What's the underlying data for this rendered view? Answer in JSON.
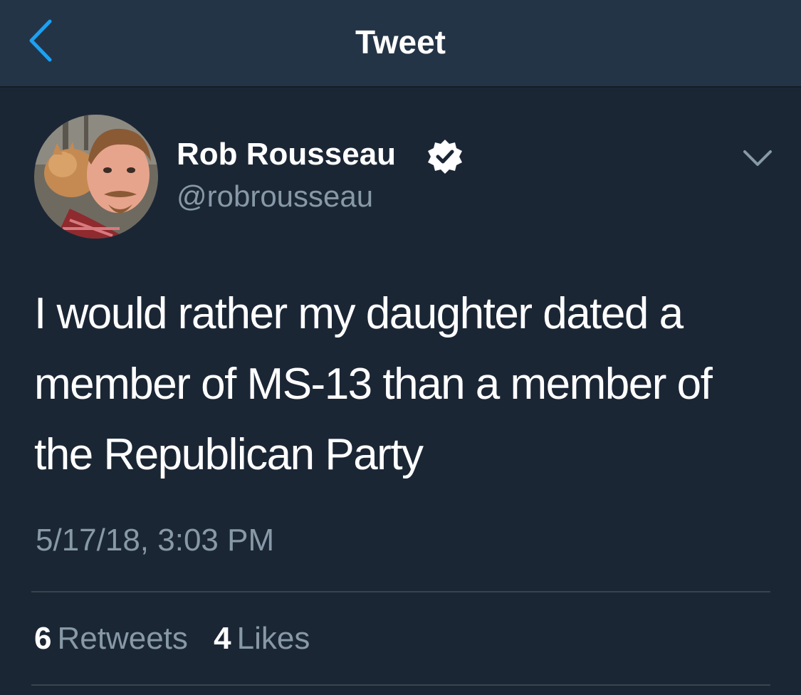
{
  "header": {
    "title": "Tweet",
    "back_icon": "chevron-left-icon"
  },
  "tweet": {
    "author": {
      "name": "Rob Rousseau",
      "handle": "@robrousseau",
      "verified": true,
      "verified_icon": "verified-badge-icon"
    },
    "more_icon": "chevron-down-icon",
    "text": "I would rather my daughter dated a member of MS-13 than a member of the Republican Party",
    "timestamp": "5/17/18, 3:03 PM",
    "stats": {
      "retweets_count": "6",
      "retweets_label": "Retweets",
      "likes_count": "4",
      "likes_label": "Likes"
    }
  },
  "colors": {
    "background": "#1b2635",
    "header_background": "#243447",
    "accent": "#1da1f2",
    "secondary_text": "#8899a6",
    "divider": "#38444d"
  }
}
